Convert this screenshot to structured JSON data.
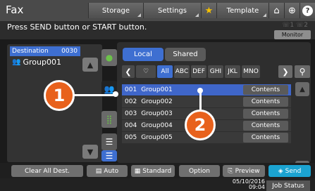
{
  "header": {
    "title": "Fax",
    "buttons": [
      "Storage",
      "Settings",
      "Template"
    ]
  },
  "message": "Press SEND button or START button.",
  "monitor_label": "Monitor",
  "destination": {
    "header_label": "Destination",
    "count": "0030",
    "selected": "Group001"
  },
  "tabs": {
    "local": "Local",
    "shared": "Shared"
  },
  "filters": [
    "All",
    "ABC",
    "DEF",
    "GHI",
    "JKL",
    "MNO"
  ],
  "groups": [
    {
      "num": "001",
      "name": "Group001",
      "action": "Contents"
    },
    {
      "num": "002",
      "name": "Group002",
      "action": "Contents"
    },
    {
      "num": "003",
      "name": "Group003",
      "action": "Contents"
    },
    {
      "num": "004",
      "name": "Group004",
      "action": "Contents"
    },
    {
      "num": "005",
      "name": "Group005",
      "action": "Contents"
    }
  ],
  "bottom": {
    "clear_all": "Clear All Dest.",
    "auto": "Auto",
    "standard": "Standard",
    "option": "Option",
    "preview": "Preview",
    "send": "Send"
  },
  "status": {
    "date": "05/10/2016",
    "time": "09:04",
    "job_status": "Job Status"
  },
  "callouts": [
    "1",
    "2"
  ],
  "colors": {
    "accent_blue": "#3e6fd1",
    "send_cyan": "#1ba3d1",
    "callout_orange": "#e8611c",
    "selected_row": "#3f66c9"
  }
}
